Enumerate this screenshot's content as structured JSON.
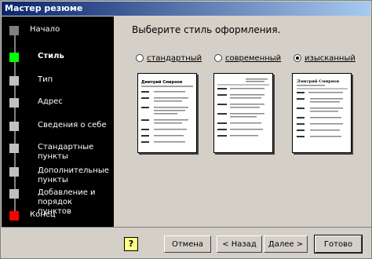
{
  "window": {
    "title": "Мастер резюме"
  },
  "steps": [
    {
      "label": "Начало"
    },
    {
      "label": "Стиль"
    },
    {
      "label": "Тип"
    },
    {
      "label": "Адрес"
    },
    {
      "label": "Сведения о себе"
    },
    {
      "label": "Стандартные пункты"
    },
    {
      "label": "Дополнительные пункты"
    },
    {
      "label": "Добавление и порядок пунктов"
    },
    {
      "label": "Конец"
    }
  ],
  "content": {
    "prompt": "Выберите стиль оформления.",
    "options": [
      {
        "label": "стандартный",
        "selected": false
      },
      {
        "label": "современный",
        "selected": false
      },
      {
        "label": "изысканный",
        "selected": true
      }
    ],
    "preview_titles": [
      "Дмитрий Смирнов",
      "",
      "Дмитрий Смирнов"
    ]
  },
  "buttons": {
    "cancel": "Отмена",
    "back": "< Назад",
    "next": "Далее >",
    "finish": "Готово",
    "help_icon": "?"
  },
  "colors": {
    "titlebar_start": "#0a246a",
    "active_step": "#00ff00",
    "end_step": "#ff0000"
  }
}
